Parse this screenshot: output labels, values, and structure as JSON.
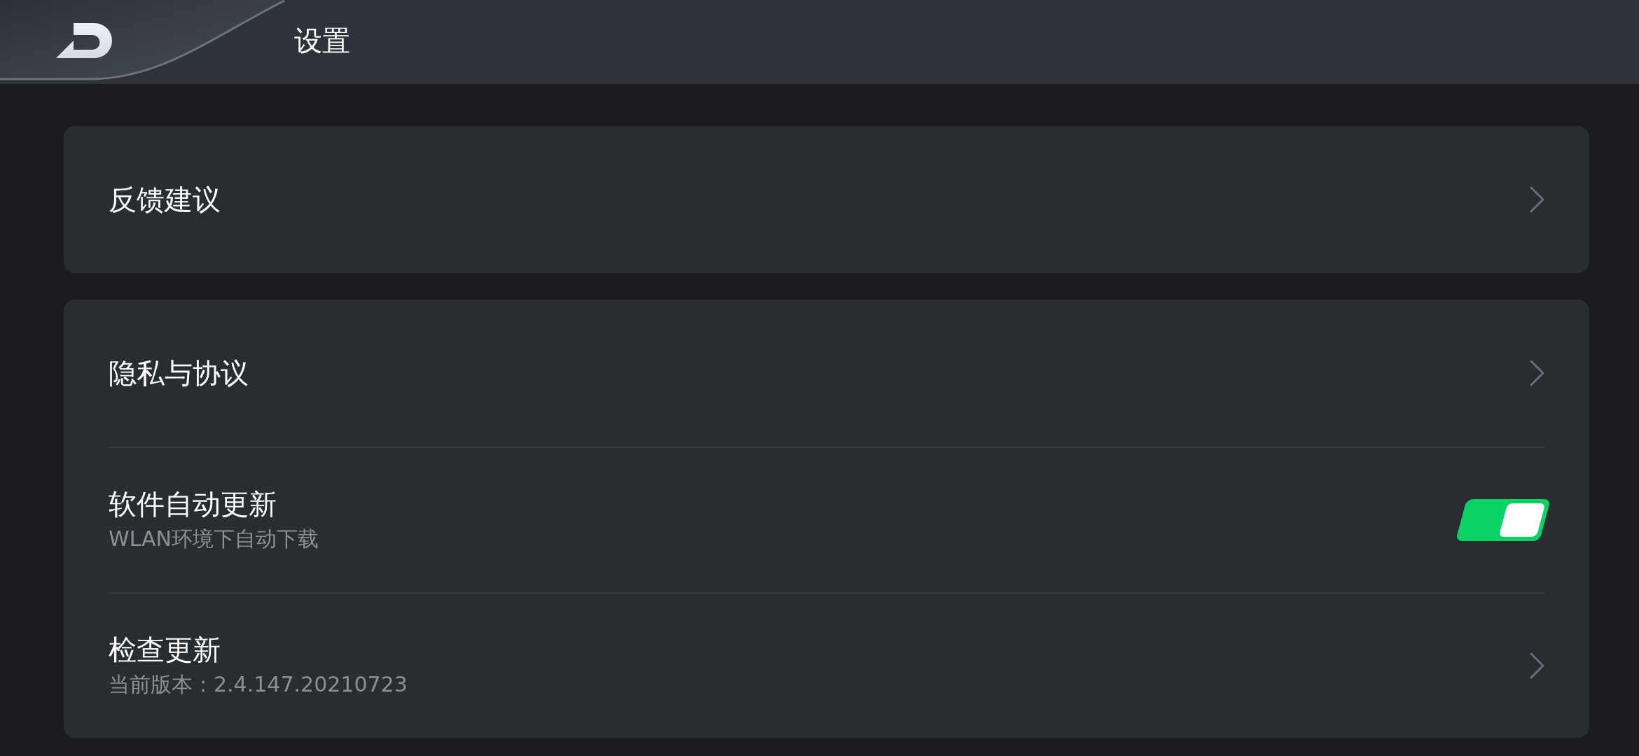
{
  "header": {
    "title": "设置"
  },
  "groups": [
    {
      "items": [
        {
          "kind": "link",
          "title": "反馈建议"
        }
      ]
    },
    {
      "items": [
        {
          "kind": "link",
          "title": "隐私与协议"
        },
        {
          "kind": "toggle",
          "title": "软件自动更新",
          "subtitle": "WLAN环境下自动下载",
          "on": true
        },
        {
          "kind": "link",
          "title": "检查更新",
          "subtitle": "当前版本：2.4.147.20210723"
        }
      ]
    }
  ]
}
